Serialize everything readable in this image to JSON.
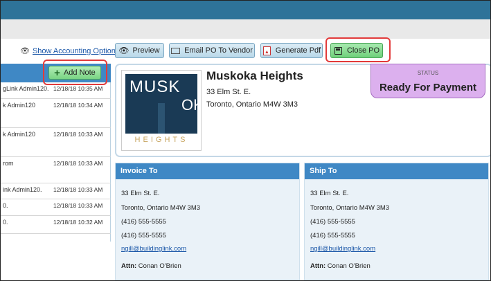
{
  "toolbar": {
    "accounting_link": "Show Accounting Options",
    "preview_label": "Preview",
    "email_label": "Email PO To Vendor",
    "generate_pdf_label": "Generate Pdf",
    "close_po_label": "Close PO"
  },
  "notes": {
    "add_note_label": "Add Note",
    "rows": [
      {
        "who": "gLink Admin120.",
        "when": "12/18/18 10:35 AM"
      },
      {
        "who": "k Admin120",
        "when": "12/18/18 10:34 AM"
      },
      {
        "who": "k Admin120",
        "when": "12/18/18 10:33 AM"
      },
      {
        "who": "rom",
        "when": "12/18/18 10:33 AM"
      },
      {
        "who": "ink Admin120.",
        "when": "12/18/18 10:33 AM"
      },
      {
        "who": "0.",
        "when": "12/18/18 10:33 AM"
      },
      {
        "who": "0.",
        "when": "12/18/18 10:32 AM"
      }
    ]
  },
  "building": {
    "logo_text_top": "MUSK",
    "logo_text_side": "OKA",
    "logo_text_bottom": "HEIGHTS",
    "name": "Muskoka Heights",
    "address_line1": "33 Elm St. E.",
    "address_line2": "Toronto, Ontario M4W 3M3"
  },
  "status": {
    "label": "STATUS",
    "value": "Ready For Payment"
  },
  "invoice_to": {
    "title": "Invoice To",
    "street": "33 Elm St. E.",
    "city": "Toronto, Ontario M4W 3M3",
    "phone1": "(416) 555-5555",
    "phone2": "(416) 555-5555",
    "email": "ngill@buildinglink.com",
    "attn_label": "Attn:",
    "attn_name": "Conan O'Brien"
  },
  "ship_to": {
    "title": "Ship To",
    "street": "33 Elm St. E.",
    "city": "Toronto, Ontario M4W 3M3",
    "phone1": "(416) 555-5555",
    "phone2": "(416) 555-5555",
    "email": "ngill@buildinglink.com",
    "attn_label": "Attn:",
    "attn_name": "Conan O'Brien"
  },
  "colors": {
    "top_bar": "#2e7399",
    "header_blue": "#3f88c5",
    "status_bg": "#dcb0ee",
    "highlight": "#e23a3a",
    "green_button": "#79d483"
  }
}
